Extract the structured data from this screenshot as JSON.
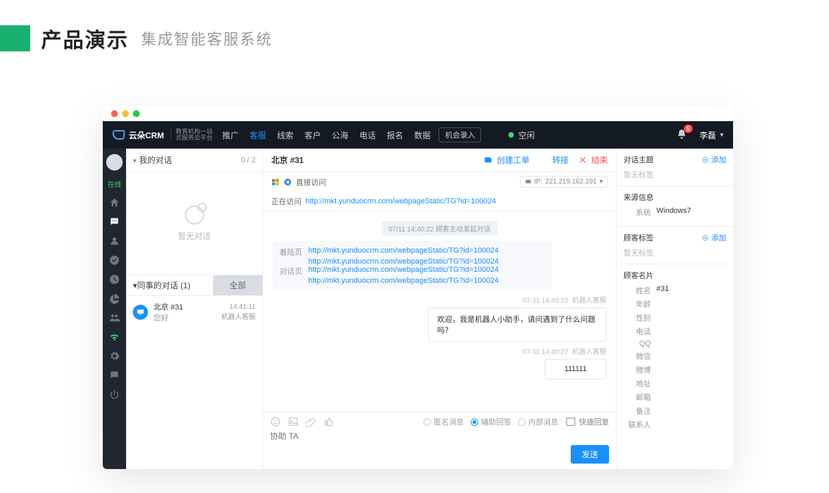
{
  "page": {
    "title": "产品演示",
    "subtitle": "集成智能客服系统"
  },
  "nav": {
    "brand": "云朵CRM",
    "brand_tag1": "教育机构一站",
    "brand_tag2": "式服务云平台",
    "items": [
      "推广",
      "客服",
      "线索",
      "客户",
      "公海",
      "电话",
      "报名",
      "数据"
    ],
    "active_index": 1,
    "record_btn": "机会录入",
    "status": "空闲",
    "bell_count": "5",
    "user": "李磊"
  },
  "rail": {
    "status": "在线"
  },
  "convlist": {
    "my_header": "我的对话",
    "my_count": "0 / 2",
    "empty": "暂无对话",
    "colleague_header": "同事的对话  (1)",
    "all_btn": "全部",
    "item": {
      "title": "北京 #31",
      "sub": "您好",
      "time": "14:41:11",
      "agent": "机器人客服"
    }
  },
  "chat": {
    "title": "北京 #31",
    "actions": {
      "ticket": "创建工单",
      "transfer": "转接",
      "end": "结束"
    },
    "visit_type": "直接访问",
    "visiting_label": "正在访问",
    "visiting_url": "http://mkt.yunduocrm.com/webpageStatic/TG?id=100024",
    "ip_label": "IP:",
    "ip": "221.219.162.191",
    "sys_pill": "07/11 14:40:22  顾客主动发起对话",
    "links": {
      "landing_label": "着陆页",
      "landing_urls": [
        "http://mkt.yunduocrm.com/webpageStatic/TG?id=100024",
        "http://mkt.yunduocrm.com/webpageStatic/TG?id=100024"
      ],
      "dialog_label": "对话页",
      "dialog_urls": [
        "http://mkt.yunduocrm.com/webpageStatic/TG?id=100024",
        "http://mkt.yunduocrm.com/webpageStatic/TG?id=100024"
      ]
    },
    "msgs": [
      {
        "time": "07-11 14:40:22",
        "who": "机器人客服",
        "text": "欢迎，我是机器人小助手，请问遇到了什么问题吗？"
      },
      {
        "time": "07-11 14:40:27",
        "who": "机器人客服",
        "text": "111111"
      }
    ],
    "composer": {
      "anon": "匿名消息",
      "assist": "辅助回答",
      "internal": "内部消息",
      "quick": "快捷回复",
      "placeholder": "协助 TA",
      "send": "发送"
    }
  },
  "info": {
    "topic_hdr": "对话主题",
    "add": "添加",
    "no_tag": "暂无标签",
    "source_hdr": "来源信息",
    "sys_label": "系统",
    "sys_val": "Windows7",
    "tags_hdr": "顾客标签",
    "card_hdr": "顾客名片",
    "fields": {
      "name": "姓名",
      "name_val": "#31",
      "age": "年龄",
      "sex": "性别",
      "phone": "电话",
      "qq": "QQ",
      "wechat": "微信",
      "weibo": "微博",
      "addr": "地址",
      "email": "邮箱",
      "note": "备注",
      "contact": "联系人"
    }
  }
}
